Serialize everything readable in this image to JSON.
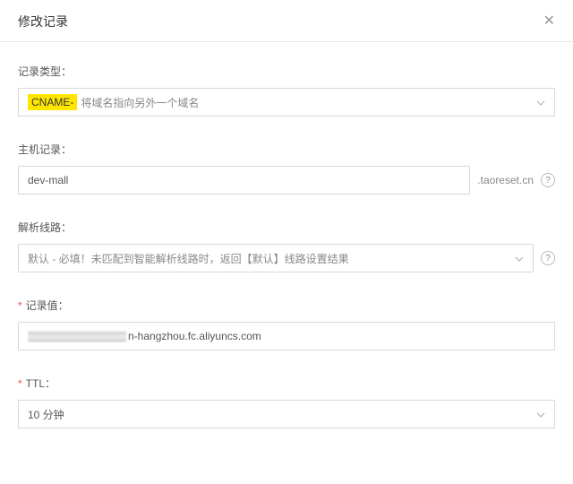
{
  "header": {
    "title": "修改记录"
  },
  "record_type": {
    "label": "记录类型：",
    "tag": "CNAME-",
    "desc": "将域名指向另外一个域名"
  },
  "host_record": {
    "label": "主机记录：",
    "value": "dev-mall",
    "suffix": ".taoreset.cn"
  },
  "resolve_line": {
    "label": "解析线路：",
    "placeholder": "默认 - 必填！未匹配到智能解析线路时，返回【默认】线路设置结果"
  },
  "record_value": {
    "label": "记录值：",
    "value_suffix": "n-hangzhou.fc.aliyuncs.com"
  },
  "ttl": {
    "label": "TTL：",
    "value": "10 分钟"
  }
}
